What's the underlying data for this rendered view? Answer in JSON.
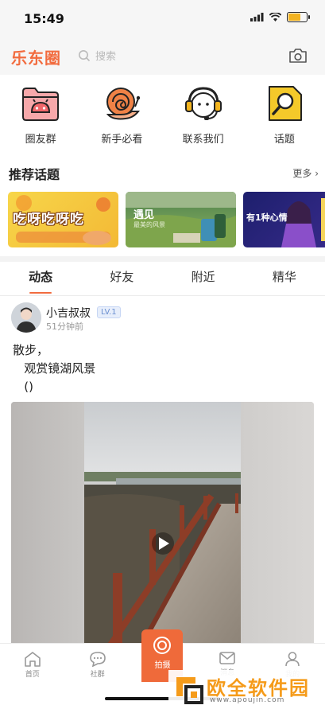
{
  "status": {
    "time": "15:49"
  },
  "header": {
    "app_title": "乐东圈",
    "search_placeholder": "搜索",
    "camera_icon": "camera-icon"
  },
  "quick_links": [
    {
      "label": "圈友群",
      "icon": "android-folder-icon",
      "color": "#f0676a"
    },
    {
      "label": "新手必看",
      "icon": "snail-icon",
      "color": "#e96b35"
    },
    {
      "label": "联系我们",
      "icon": "headset-icon",
      "color": "#f4b51f"
    },
    {
      "label": "话题",
      "icon": "search-topic-icon",
      "color": "#f4c92a"
    }
  ],
  "recommended": {
    "title": "推荐话题",
    "more_label": "更多 ›",
    "topics": [
      {
        "text": "吃呀吃呀吃"
      },
      {
        "text": "遇见",
        "sub": "最美的风景"
      },
      {
        "text": "有1种心情"
      }
    ]
  },
  "tabs": [
    "动态",
    "好友",
    "附近",
    "精华"
  ],
  "active_tab": 0,
  "post": {
    "username": "小吉叔叔",
    "level": "LV.1",
    "time": "51分钟前",
    "text": "散步，\n   观赏镜湖风景\n   ()"
  },
  "bottom_nav": [
    {
      "label": "首页",
      "icon": "home-icon"
    },
    {
      "label": "社群",
      "icon": "chat-icon"
    },
    {
      "label": "拍摄",
      "icon": "shoot-icon"
    },
    {
      "label": "消息",
      "icon": "message-icon"
    },
    {
      "label": "我的",
      "icon": "profile-icon"
    }
  ],
  "watermark": {
    "title": "欧全软件园",
    "url": "www.apoujin.com"
  },
  "colors": {
    "accent": "#f26c3f",
    "shoot": "#ef6a3a"
  }
}
